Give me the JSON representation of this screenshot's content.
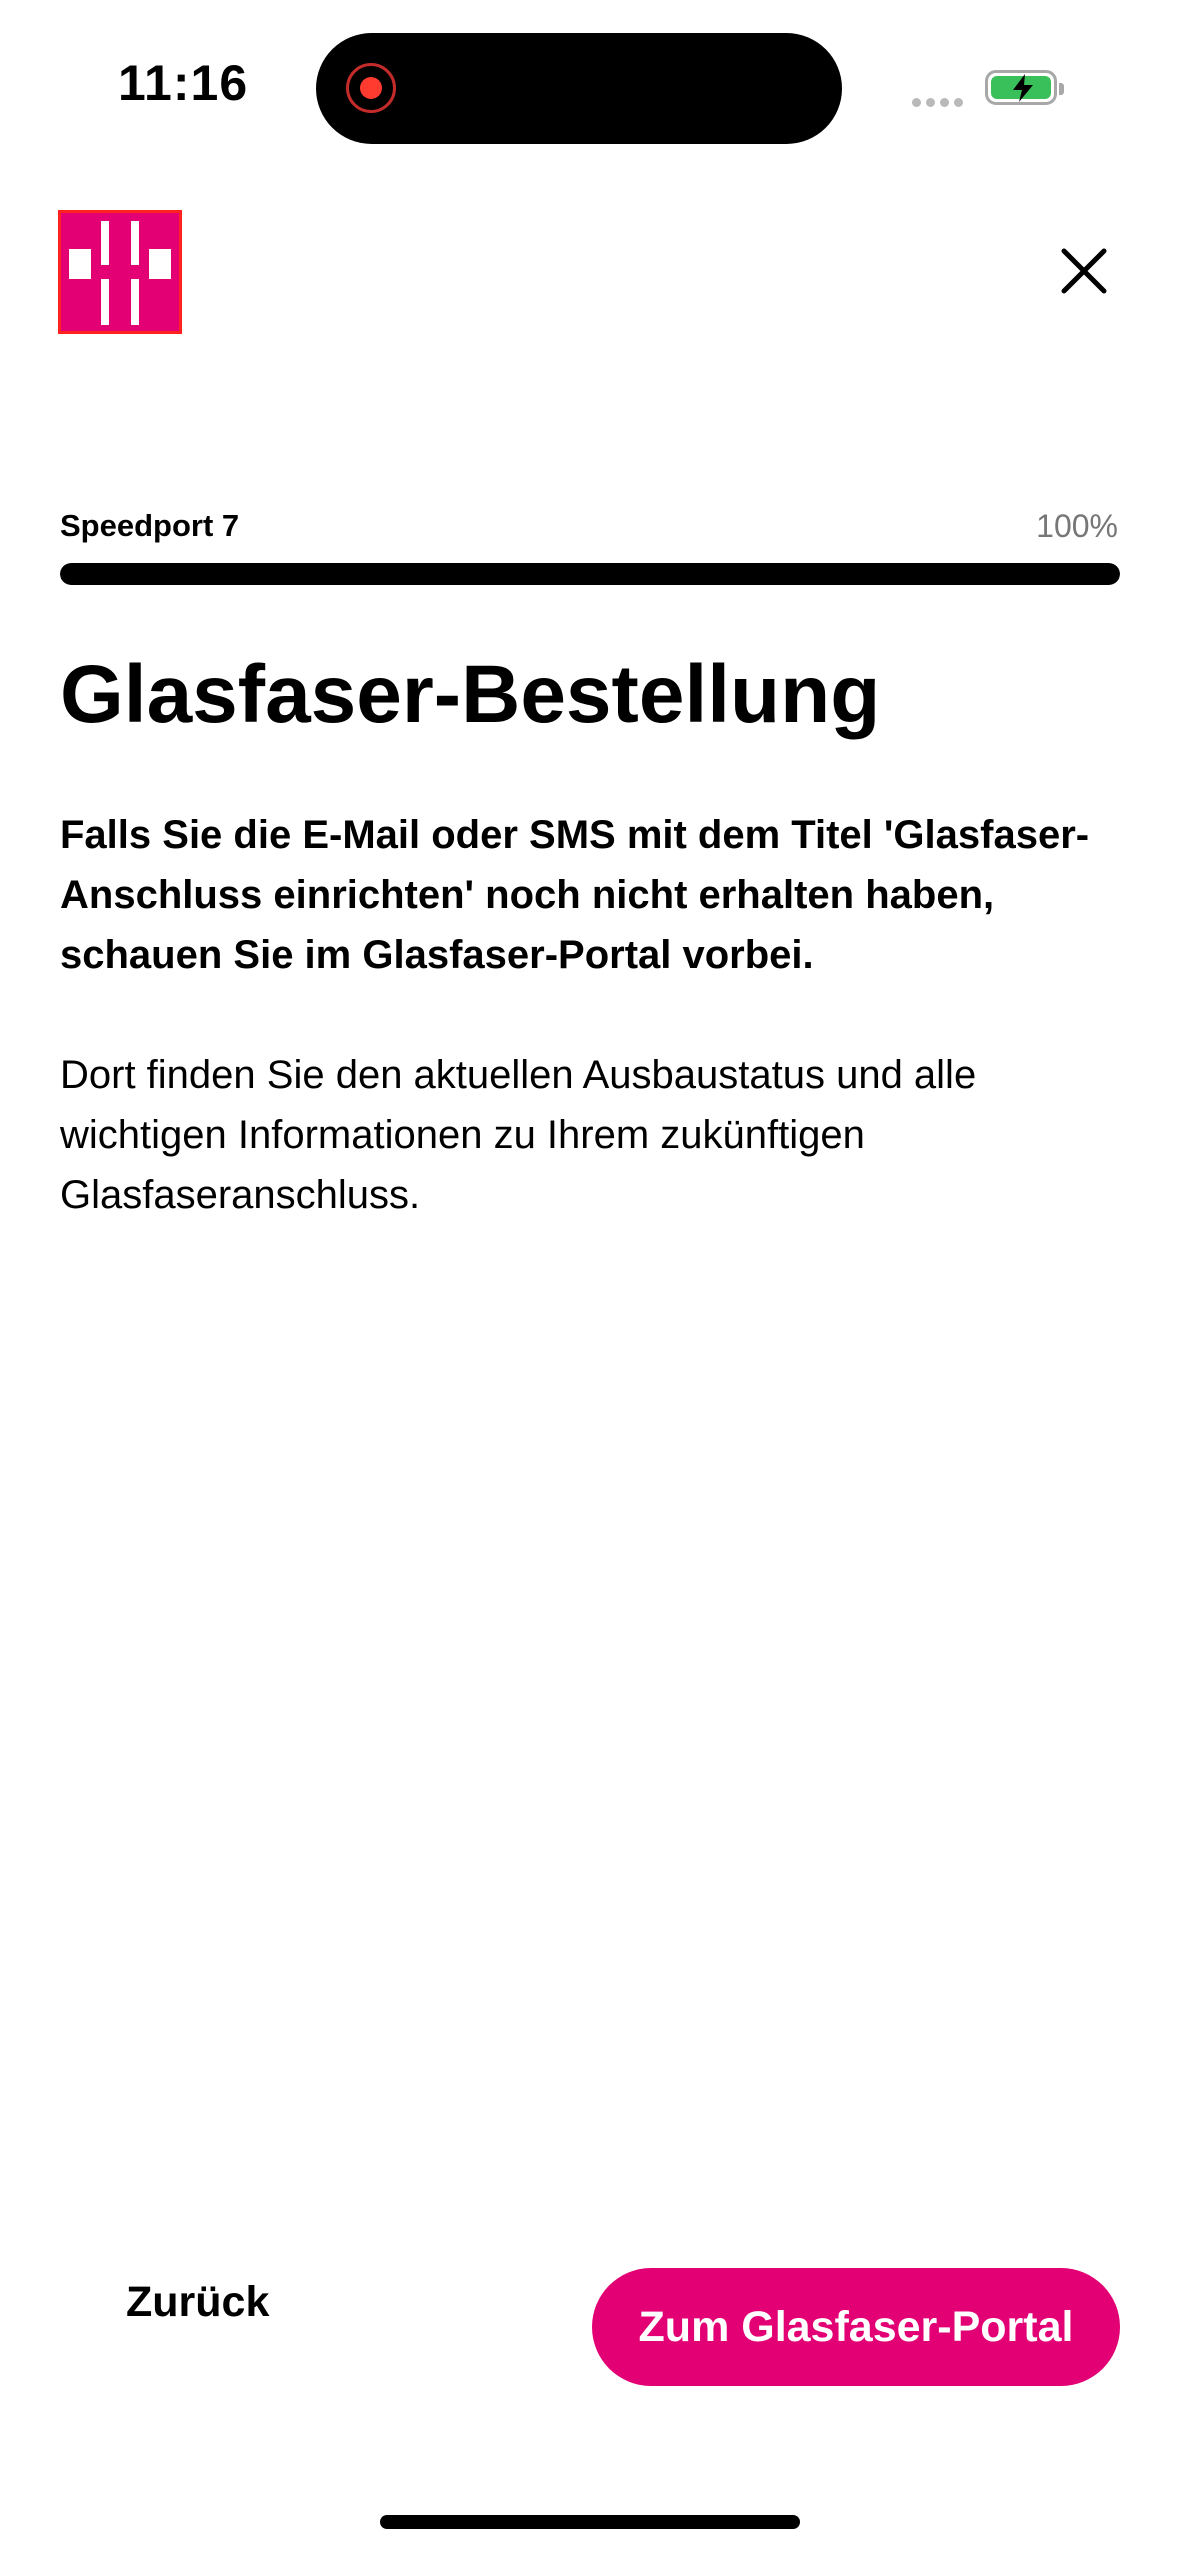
{
  "status_bar": {
    "time": "11:16",
    "battery_color": "#3ac05a",
    "recording_indicator_color": "#ff3b30"
  },
  "header": {
    "logo_icon": "telekom-t-logo",
    "close_icon": "close-icon"
  },
  "progress": {
    "label": "Speedport 7",
    "value_text": "100%",
    "percent": 100
  },
  "main": {
    "title": "Glasfaser-Bestellung",
    "paragraph_bold": "Falls Sie die E-Mail oder SMS mit dem Titel 'Glasfaser-Anschluss einrichten' noch nicht erhalten haben, schauen Sie im Glasfaser-Portal vorbei.",
    "paragraph": "Dort finden Sie den aktuellen Ausbaustatus und alle wichtigen Informationen zu Ihrem zukünftigen Glasfaseranschluss."
  },
  "actions": {
    "back_label": "Zurück",
    "primary_label": "Zum Glasfaser-Portal",
    "accent_color": "#e20074"
  }
}
